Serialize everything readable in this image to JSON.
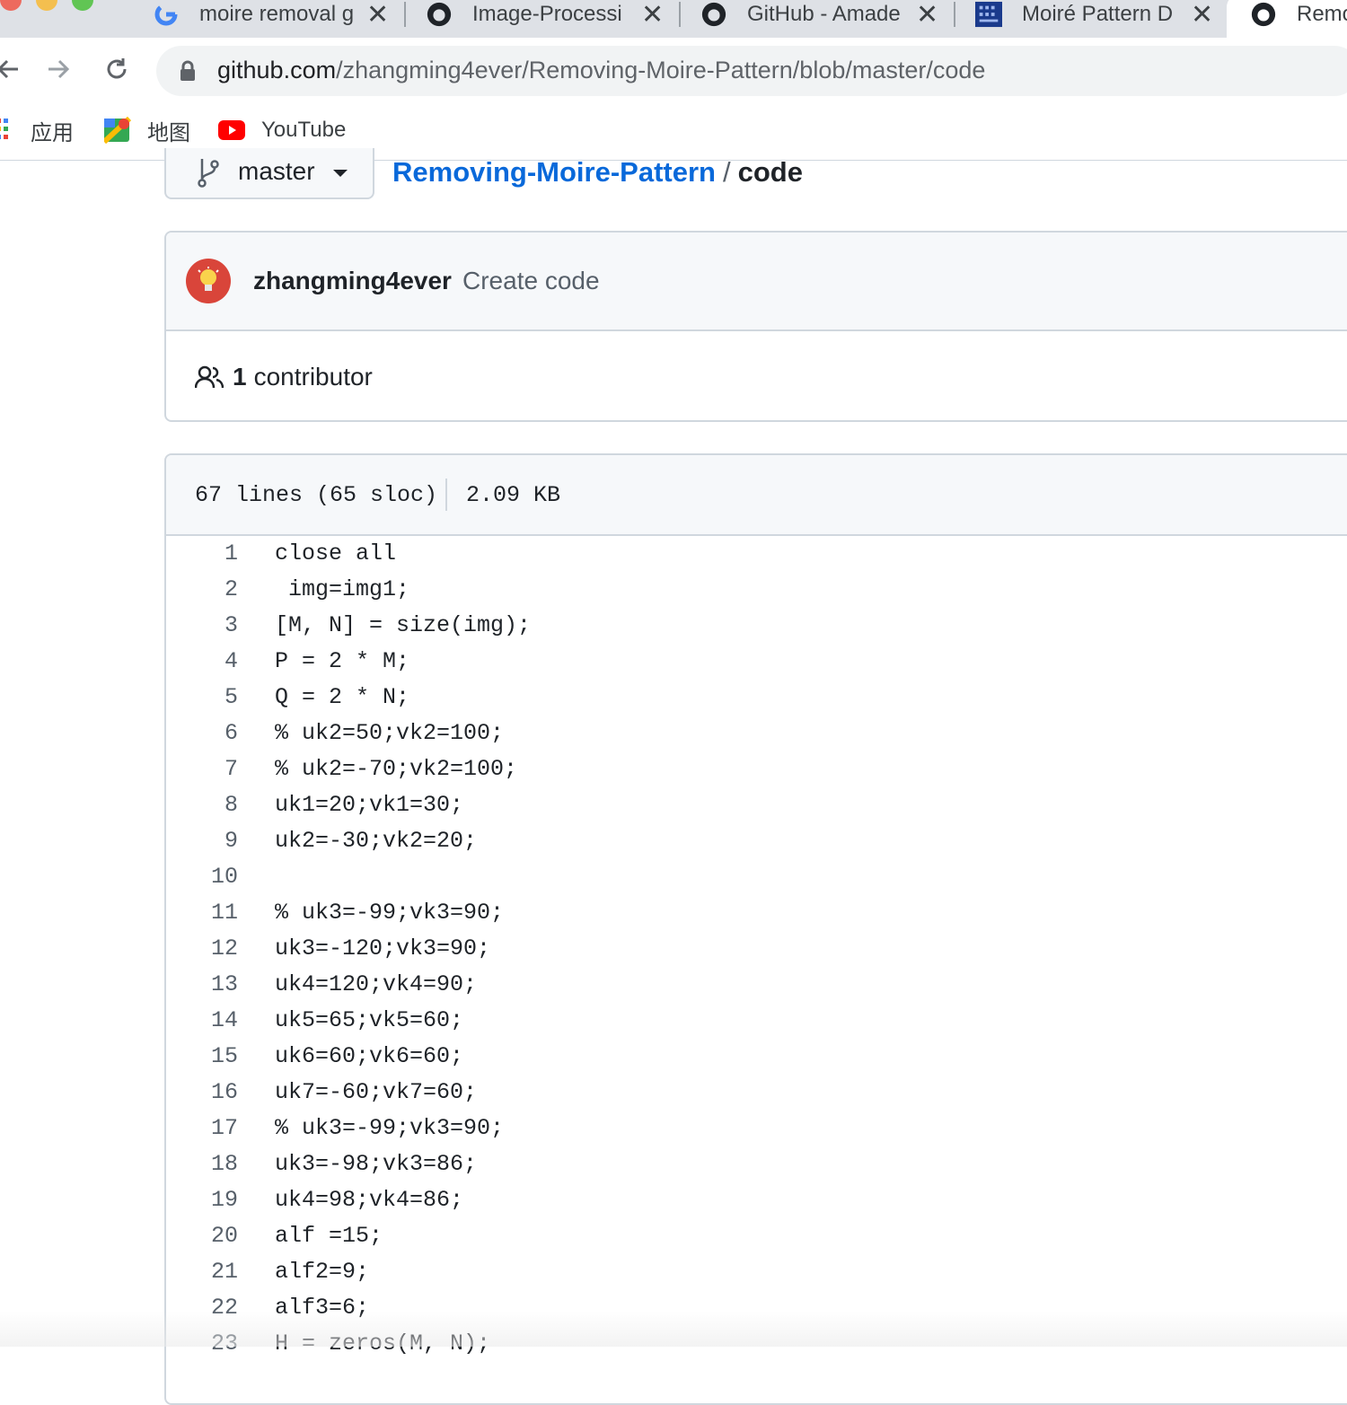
{
  "tabs": [
    {
      "title": "moire removal g",
      "icon": "google-icon"
    },
    {
      "title": "Image-Processi",
      "icon": "github-icon"
    },
    {
      "title": "GitHub - Amade",
      "icon": "github-icon"
    },
    {
      "title": "Moiré Pattern D",
      "icon": "building-icon"
    },
    {
      "title": "Remo",
      "icon": "github-icon"
    }
  ],
  "address_bar": {
    "host": "github.com",
    "path": "/zhangming4ever/Removing-Moire-Pattern/blob/master/code"
  },
  "bookmarks": [
    {
      "label": "应用",
      "icon": "apps-grid-icon"
    },
    {
      "label": "地图",
      "icon": "maps-icon"
    },
    {
      "label": "YouTube",
      "icon": "youtube-icon"
    }
  ],
  "branch": {
    "name": "master"
  },
  "breadcrumb": {
    "repo": "Removing-Moire-Pattern",
    "separator": "/",
    "file": "code"
  },
  "commit": {
    "author": "zhangming4ever",
    "message": "Create code"
  },
  "contributors": {
    "count": "1",
    "label": "contributor"
  },
  "file_info": {
    "lines": "67 lines (65 sloc)",
    "size": "2.09 KB"
  },
  "code_lines": [
    {
      "n": "1",
      "text": "close all"
    },
    {
      "n": "2",
      "text": " img=img1;"
    },
    {
      "n": "3",
      "text": "[M, N] = size(img);"
    },
    {
      "n": "4",
      "text": "P = 2 * M;"
    },
    {
      "n": "5",
      "text": "Q = 2 * N;"
    },
    {
      "n": "6",
      "text": "% uk2=50;vk2=100;"
    },
    {
      "n": "7",
      "text": "% uk2=-70;vk2=100;"
    },
    {
      "n": "8",
      "text": "uk1=20;vk1=30;"
    },
    {
      "n": "9",
      "text": "uk2=-30;vk2=20;"
    },
    {
      "n": "10",
      "text": ""
    },
    {
      "n": "11",
      "text": "% uk3=-99;vk3=90;"
    },
    {
      "n": "12",
      "text": "uk3=-120;vk3=90;"
    },
    {
      "n": "13",
      "text": "uk4=120;vk4=90;"
    },
    {
      "n": "14",
      "text": "uk5=65;vk5=60;"
    },
    {
      "n": "15",
      "text": "uk6=60;vk6=60;"
    },
    {
      "n": "16",
      "text": "uk7=-60;vk7=60;"
    },
    {
      "n": "17",
      "text": "% uk3=-99;vk3=90;"
    },
    {
      "n": "18",
      "text": "uk3=-98;vk3=86;"
    },
    {
      "n": "19",
      "text": "uk4=98;vk4=86;"
    },
    {
      "n": "20",
      "text": "alf =15;"
    },
    {
      "n": "21",
      "text": "alf2=9;"
    },
    {
      "n": "22",
      "text": "alf3=6;"
    },
    {
      "n": "23",
      "text": "H = zeros(M, N);"
    }
  ],
  "colors": {
    "link": "#0969da",
    "border": "#d0d7de",
    "header_bg": "#f6f8fa",
    "avatar": "#d9453a"
  }
}
